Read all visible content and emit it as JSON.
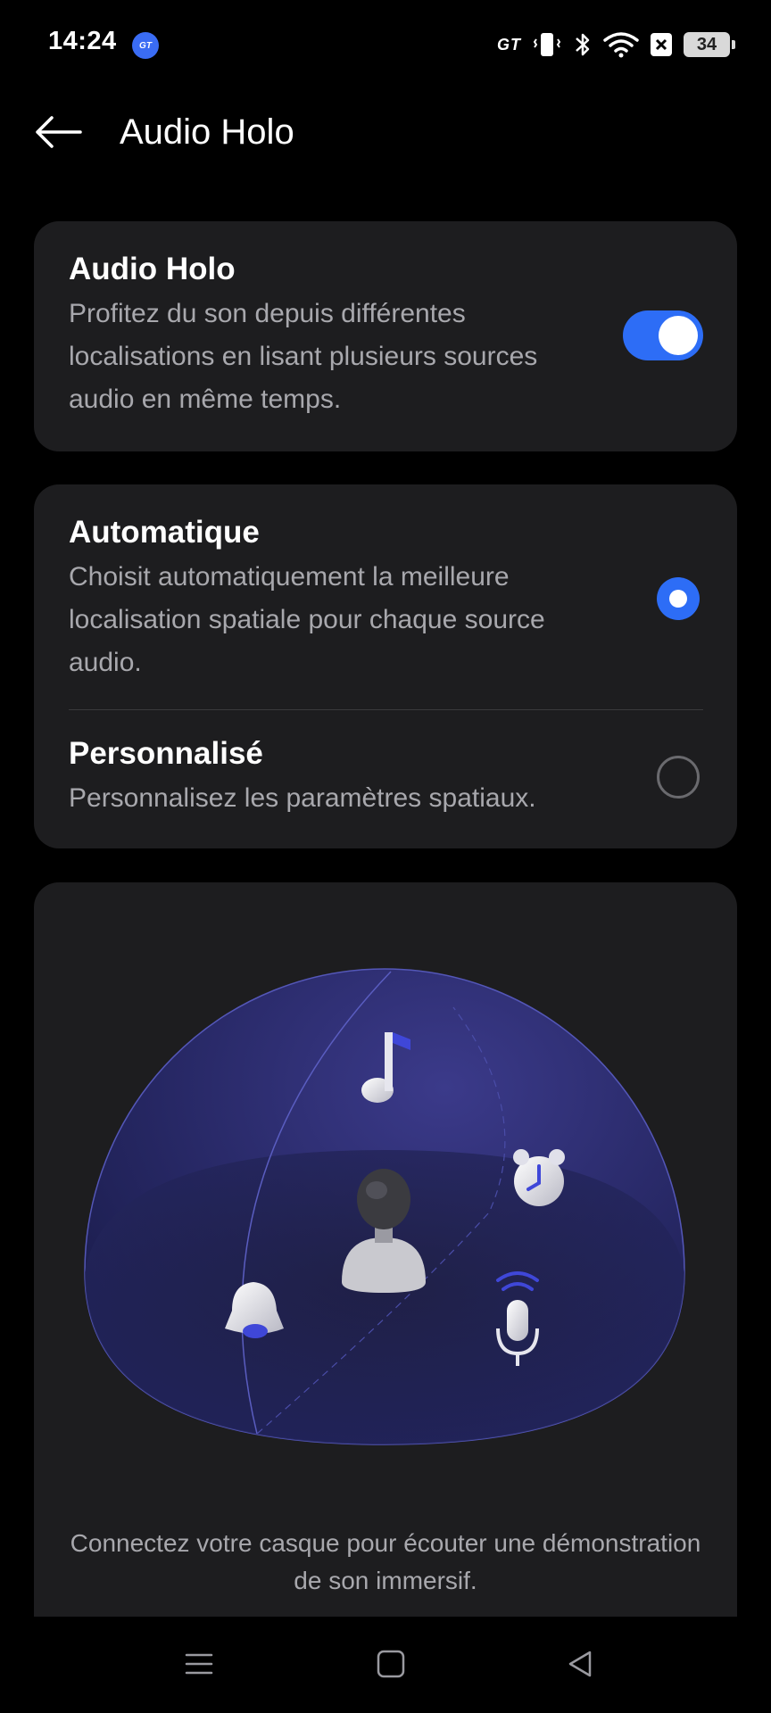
{
  "status_bar": {
    "time": "14:24",
    "badge": "GT",
    "brand_logo": "GT",
    "battery": "34",
    "icons": [
      "vibrate-icon",
      "bluetooth-icon",
      "wifi-icon",
      "no-sim-icon",
      "battery-icon"
    ]
  },
  "header": {
    "title": "Audio Holo",
    "back_icon": "arrow-left-icon"
  },
  "holo_card": {
    "title": "Audio Holo",
    "description": "Profitez du son depuis différentes localisations en lisant plusieurs sources audio en même temps.",
    "enabled": true
  },
  "modes": [
    {
      "title": "Automatique",
      "description": "Choisit automatiquement la meilleure localisation spatiale pour chaque source audio.",
      "selected": true
    },
    {
      "title": "Personnalisé",
      "description": "Personnalisez les paramètres spatiaux.",
      "selected": false
    }
  ],
  "demo": {
    "caption": "Connectez votre casque pour écouter une démonstration de son immersif.",
    "icons": [
      "music-note-icon",
      "alarm-clock-icon",
      "listener-avatar-icon",
      "bell-icon",
      "microphone-icon"
    ]
  },
  "nav_bar": {
    "icons": [
      "menu-icon",
      "home-icon",
      "back-triangle-icon"
    ]
  },
  "colors": {
    "accent": "#2d6df6",
    "card_bg": "#1d1d1f",
    "secondary_text": "#a8a8ad"
  }
}
